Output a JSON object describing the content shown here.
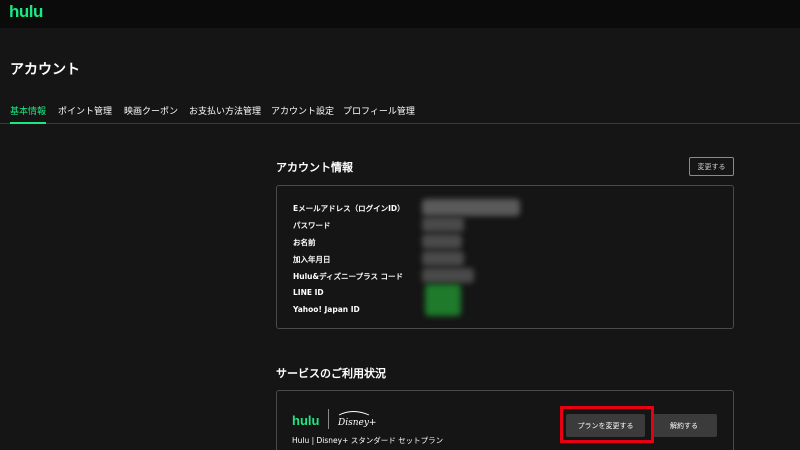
{
  "header": {
    "logo": "hulu"
  },
  "page": {
    "title": "アカウント"
  },
  "tabs": [
    {
      "label": "基本情報",
      "active": true
    },
    {
      "label": "ポイント管理"
    },
    {
      "label": "映画クーポン"
    },
    {
      "label": "お支払い方法管理"
    },
    {
      "label": "アカウント設定"
    },
    {
      "label": "プロフィール管理"
    }
  ],
  "account_info": {
    "title": "アカウント情報",
    "edit_label": "変更する",
    "fields": [
      {
        "label": "Eメールアドレス（ログインID）"
      },
      {
        "label": "パスワード"
      },
      {
        "label": "お名前"
      },
      {
        "label": "加入年月日"
      },
      {
        "label": "Hulu&ディズニープラス コード"
      },
      {
        "label": "LINE ID"
      },
      {
        "label": "Yahoo! Japan ID"
      }
    ]
  },
  "service": {
    "title": "サービスのご利用状況",
    "logo_hulu": "hulu",
    "plan_name": "Hulu | Disney+ スタンダード セットプラン",
    "change_plan_label": "プランを変更する",
    "cancel_label": "解約する"
  },
  "colors": {
    "accent": "#1ce783",
    "highlight": "#e60012",
    "background": "#151515"
  }
}
